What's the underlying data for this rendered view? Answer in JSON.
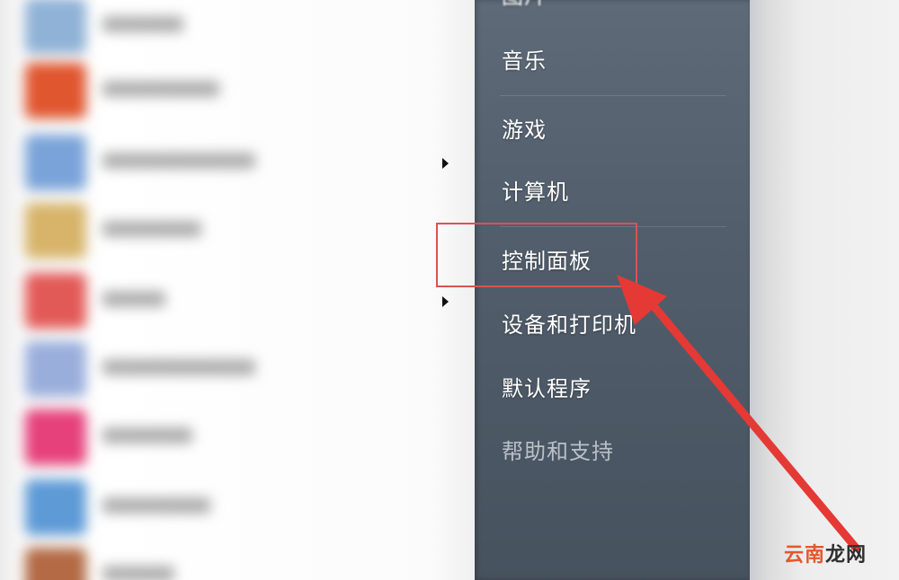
{
  "start_menu": {
    "places": [
      {
        "label": "图片",
        "cut": true
      },
      {
        "label": "音乐"
      },
      {
        "label": "游戏"
      },
      {
        "label": "计算机"
      },
      {
        "label": "控制面板",
        "highlighted": true
      },
      {
        "label": "设备和打印机"
      },
      {
        "label": "默认程序"
      },
      {
        "label": "帮助和支持",
        "dim": true
      }
    ]
  },
  "programs": [
    {
      "icon_color": "#8fb2d6"
    },
    {
      "icon_color": "#e0562f"
    },
    {
      "icon_color": "#7aa3d9"
    },
    {
      "icon_color": "#d7b46a"
    },
    {
      "icon_color": "#e25a57"
    },
    {
      "icon_color": "#9aaedc"
    },
    {
      "icon_color": "#e6417a"
    },
    {
      "icon_color": "#5d9ad6"
    },
    {
      "icon_color": "#b36a45"
    }
  ],
  "annotation": {
    "box_color": "#d9544f",
    "arrow_color": "#e53935"
  },
  "watermark": {
    "part1": "云南",
    "part2": "龙网"
  }
}
